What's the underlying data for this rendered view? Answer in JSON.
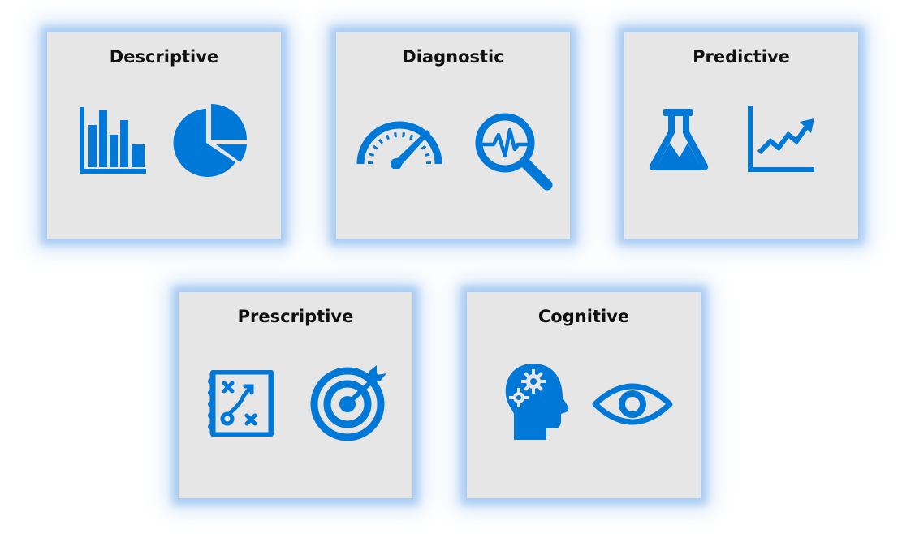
{
  "accent_color": "#0078d7",
  "card_color": "#e6e6e6",
  "cards": [
    {
      "title": "Descriptive",
      "icons": [
        "bar-chart-icon",
        "pie-chart-icon"
      ]
    },
    {
      "title": "Diagnostic",
      "icons": [
        "speedometer-icon",
        "magnifier-pulse-icon"
      ]
    },
    {
      "title": "Predictive",
      "icons": [
        "flask-icon",
        "trend-chart-icon"
      ]
    },
    {
      "title": "Prescriptive",
      "icons": [
        "strategy-notebook-icon",
        "target-icon"
      ]
    },
    {
      "title": "Cognitive",
      "icons": [
        "head-gears-icon",
        "eye-icon"
      ]
    }
  ]
}
